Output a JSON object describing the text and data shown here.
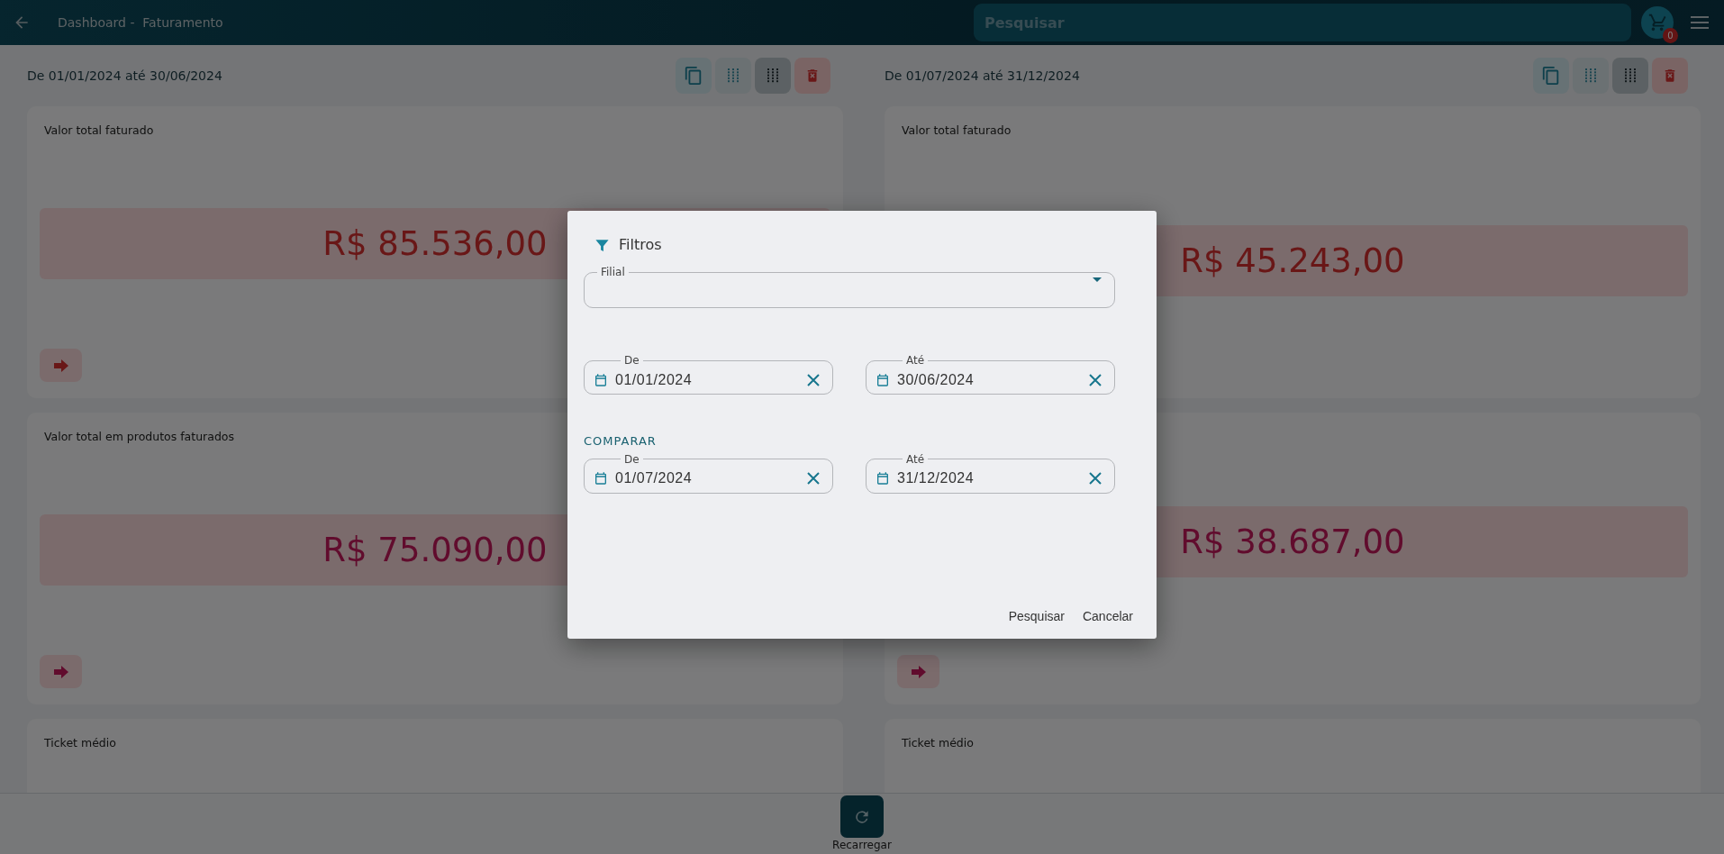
{
  "top_bar": {
    "title": "Dashboard -  Faturamento",
    "search": {
      "placeholder": "Pesquisar"
    },
    "cart_count": "0"
  },
  "columns": [
    {
      "period": "De 01/01/2024 até 30/06/2024",
      "toolbar": [
        {
          "kind": "copy"
        },
        {
          "kind": "grid-sparse",
          "selected": false
        },
        {
          "kind": "grid-dense",
          "selected": true
        },
        {
          "kind": "delete"
        }
      ],
      "cards": [
        {
          "title": "Valor total faturado",
          "amount": "R$ 85.536,00",
          "kind": "invoiced",
          "arrow": true
        },
        {
          "title": "Valor total em produtos faturados",
          "amount": "R$ 75.090,00",
          "kind": "products",
          "arrow": true
        },
        {
          "title": "Ticket médio"
        }
      ]
    },
    {
      "period": "De 01/07/2024 até 31/12/2024",
      "toolbar": [
        {
          "kind": "copy"
        },
        {
          "kind": "grid-sparse",
          "selected": false
        },
        {
          "kind": "grid-dense",
          "selected": true
        },
        {
          "kind": "delete"
        }
      ],
      "cards": [
        {
          "title": "Valor total faturado",
          "amount": "R$ 45.243,00",
          "kind": "invoiced"
        },
        {
          "amount": "R$ 38.687,00",
          "kind": "products",
          "arrow": true
        },
        {
          "title": "Ticket médio"
        }
      ]
    }
  ],
  "bottom_bar": {
    "reload_label": "Recarregar"
  },
  "filter_dialog": {
    "title": "Filtros",
    "branch_field": {
      "label": "Filial"
    },
    "period": [
      {
        "label": "De",
        "value": "01/01/2024"
      },
      {
        "label": "Até",
        "value": "30/06/2024"
      }
    ],
    "compare_heading": "COMPARAR",
    "compare": [
      {
        "label": "De",
        "value": "01/07/2024"
      },
      {
        "label": "Até",
        "value": "31/12/2024"
      }
    ],
    "buttons": [
      "Pesquisar",
      "Cancelar"
    ]
  }
}
